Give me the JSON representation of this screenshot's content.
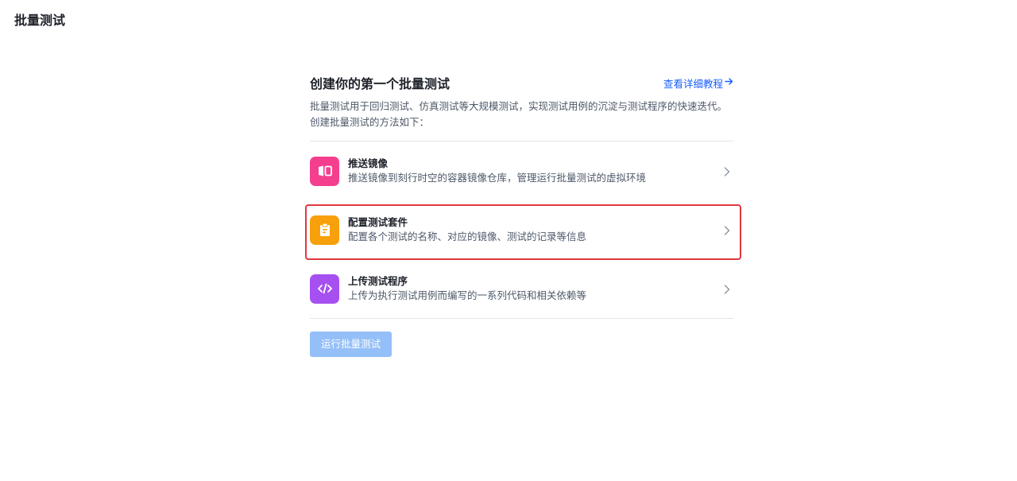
{
  "page": {
    "title": "批量测试"
  },
  "panel": {
    "title": "创建你的第一个批量测试",
    "tutorial_link": "查看详细教程",
    "intro": "批量测试用于回归测试、仿真测试等大规模测试，实现测试用例的沉淀与测试程序的快速迭代。创建批量测试的方法如下："
  },
  "steps": [
    {
      "title": "推送镜像",
      "desc": "推送镜像到刻行时空的容器镜像仓库，管理运行批量测试的虚拟环境",
      "icon": "mirror-image-icon",
      "color": "#f43f8e"
    },
    {
      "title": "配置测试套件",
      "desc": "配置各个测试的名称、对应的镜像、测试的记录等信息",
      "icon": "clipboard-icon",
      "color": "#f7a00b"
    },
    {
      "title": "上传测试程序",
      "desc": "上传为执行测试用例而编写的一系列代码和相关依赖等",
      "icon": "code-icon",
      "color": "#a650f1"
    }
  ],
  "actions": {
    "run_label": "运行批量测试"
  },
  "colors": {
    "link": "#165dff",
    "highlight_border": "#e0383e",
    "disabled_button": "#94bff8"
  }
}
